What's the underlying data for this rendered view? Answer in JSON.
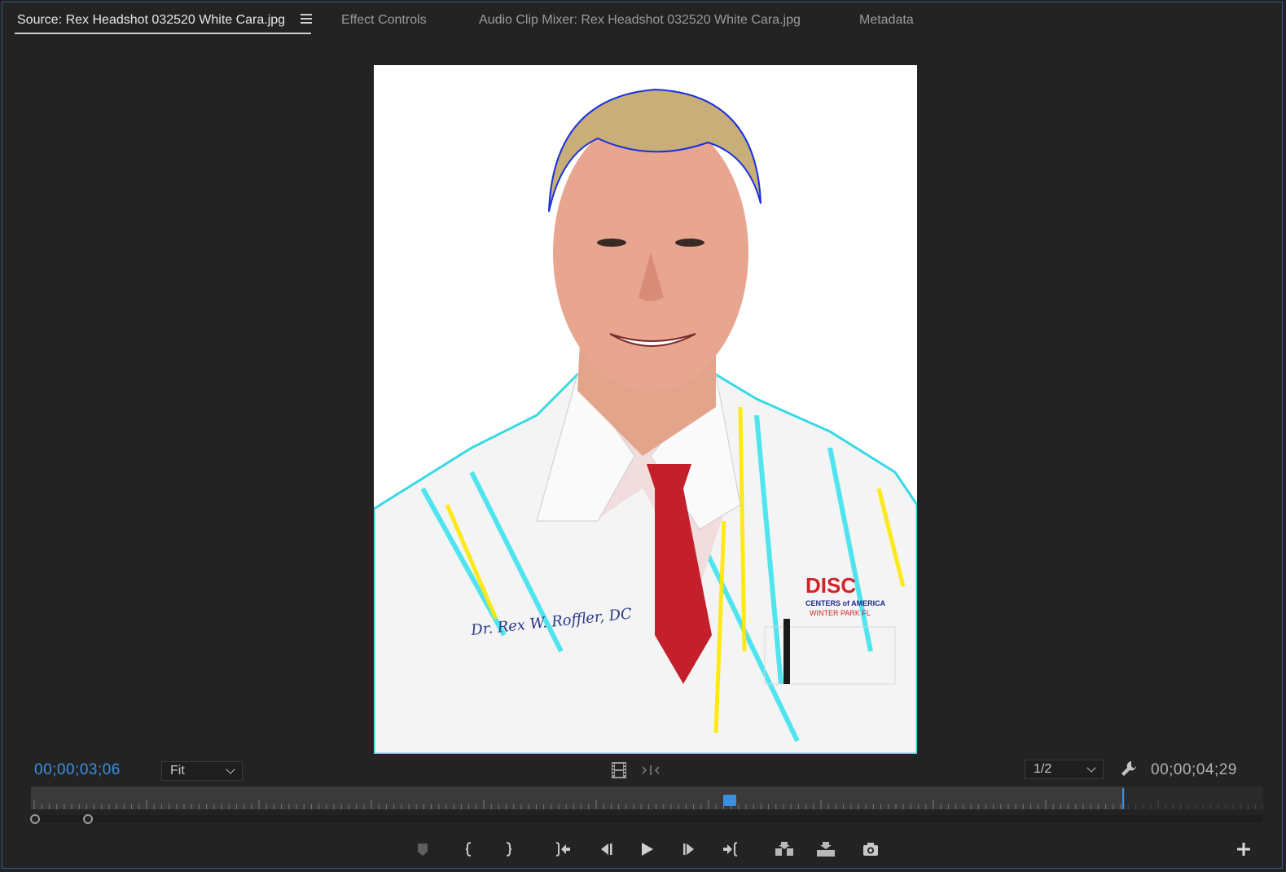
{
  "tabs": [
    {
      "label": "Source: Rex Headshot 032520 White Cara.jpg",
      "active": true
    },
    {
      "label": "Effect Controls",
      "active": false
    },
    {
      "label": "Audio Clip Mixer: Rex Headshot 032520 White Cara.jpg",
      "active": false
    },
    {
      "label": "Metadata",
      "active": false
    }
  ],
  "image": {
    "embroidery_text": "Dr. Rex W. Roffler, DC",
    "logo_text": "DISC",
    "logo_sub": "CENTERS of AMERICA",
    "logo_city": "WINTER PARK FL"
  },
  "timecode": {
    "current": "00;00;03;06",
    "duration": "00;00;04;29"
  },
  "zoom": {
    "selected": "Fit"
  },
  "resolution": {
    "selected": "1/2"
  },
  "playhead_fraction": 0.639,
  "colors": {
    "accent": "#3d8fe0",
    "panel_bg": "#232323"
  },
  "icons": {
    "panel_menu": "hamburger-icon",
    "settings": "wrench-icon",
    "add": "plus-icon"
  }
}
